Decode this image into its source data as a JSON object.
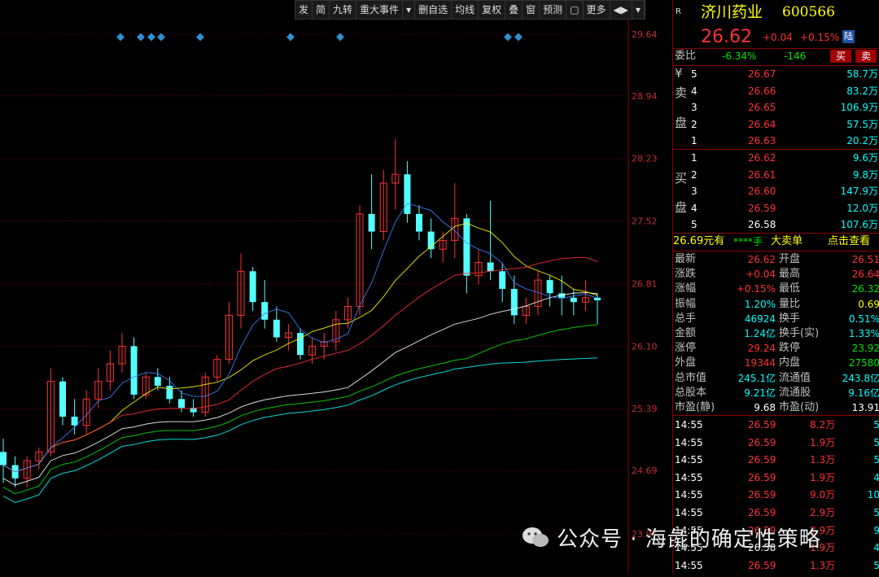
{
  "toolbar": {
    "items": [
      "发",
      "简",
      "九转",
      "重大事件",
      "▾",
      "删自选",
      "均线",
      "复权",
      "叠",
      "窗",
      "预测",
      "▢",
      "更多",
      "◀▶",
      "▾"
    ]
  },
  "chart": {
    "price_labels": [
      "29.64",
      "28.94",
      "28.23",
      "27.52",
      "26.81",
      "26.10",
      "25.39",
      "24.69",
      "23.97"
    ],
    "price_min": 23.97,
    "price_max": 29.64,
    "marker_x": [
      148,
      173,
      186,
      198,
      246,
      357,
      418,
      624,
      637
    ],
    "candles": [
      [
        24.9,
        25.05,
        24.55,
        24.75
      ],
      [
        24.75,
        24.85,
        24.5,
        24.6
      ],
      [
        24.6,
        24.85,
        24.5,
        24.8
      ],
      [
        24.8,
        24.95,
        24.7,
        24.9
      ],
      [
        24.9,
        25.85,
        24.85,
        25.7
      ],
      [
        25.7,
        25.75,
        25.2,
        25.3
      ],
      [
        25.3,
        25.5,
        25.1,
        25.2
      ],
      [
        25.2,
        25.6,
        25.1,
        25.5
      ],
      [
        25.5,
        25.85,
        25.4,
        25.7
      ],
      [
        25.7,
        26.05,
        25.6,
        25.9
      ],
      [
        25.9,
        26.25,
        25.8,
        26.1
      ],
      [
        26.1,
        26.2,
        25.5,
        25.55
      ],
      [
        25.55,
        25.8,
        25.5,
        25.75
      ],
      [
        25.75,
        25.85,
        25.6,
        25.65
      ],
      [
        25.65,
        25.75,
        25.45,
        25.5
      ],
      [
        25.5,
        25.6,
        25.35,
        25.4
      ],
      [
        25.4,
        25.5,
        25.3,
        25.35
      ],
      [
        25.35,
        25.8,
        25.3,
        25.75
      ],
      [
        25.75,
        26.0,
        25.7,
        25.95
      ],
      [
        25.95,
        26.6,
        25.9,
        26.45
      ],
      [
        26.45,
        27.15,
        26.3,
        26.95
      ],
      [
        26.95,
        27.0,
        26.5,
        26.6
      ],
      [
        26.6,
        26.85,
        26.3,
        26.4
      ],
      [
        26.4,
        26.55,
        26.15,
        26.2
      ],
      [
        26.2,
        26.35,
        26.05,
        26.25
      ],
      [
        26.25,
        26.3,
        25.95,
        26.0
      ],
      [
        26.0,
        26.2,
        25.9,
        26.1
      ],
      [
        26.1,
        26.25,
        25.95,
        26.15
      ],
      [
        26.15,
        26.5,
        26.05,
        26.4
      ],
      [
        26.4,
        26.65,
        26.3,
        26.55
      ],
      [
        26.55,
        27.7,
        26.45,
        27.6
      ],
      [
        27.6,
        28.05,
        27.2,
        27.4
      ],
      [
        27.4,
        28.1,
        27.3,
        27.95
      ],
      [
        27.95,
        28.45,
        27.65,
        28.05
      ],
      [
        28.05,
        28.2,
        27.5,
        27.6
      ],
      [
        27.6,
        27.7,
        27.3,
        27.4
      ],
      [
        27.4,
        27.55,
        27.1,
        27.2
      ],
      [
        27.2,
        27.4,
        27.05,
        27.3
      ],
      [
        27.3,
        27.95,
        27.1,
        27.55
      ],
      [
        27.55,
        27.6,
        26.7,
        26.9
      ],
      [
        26.9,
        27.2,
        26.8,
        27.05
      ],
      [
        27.05,
        27.75,
        26.85,
        26.95
      ],
      [
        26.95,
        27.05,
        26.6,
        26.75
      ],
      [
        26.75,
        26.9,
        26.35,
        26.45
      ],
      [
        26.45,
        26.65,
        26.35,
        26.55
      ],
      [
        26.55,
        26.95,
        26.45,
        26.85
      ],
      [
        26.85,
        26.9,
        26.55,
        26.7
      ],
      [
        26.7,
        26.9,
        26.45,
        26.65
      ],
      [
        26.65,
        26.75,
        26.45,
        26.6
      ],
      [
        26.6,
        26.85,
        26.5,
        26.65
      ],
      [
        26.65,
        26.7,
        26.35,
        26.62
      ]
    ],
    "ma_colors": [
      "#ffffff",
      "#ffff00",
      "#ff3232",
      "#00e600",
      "#00ffff",
      "#4080ff"
    ]
  },
  "stock": {
    "code_label": "R",
    "name": "济川药业",
    "code": "600566",
    "price": "26.62",
    "change": "+0.04",
    "change_pct": "+0.15%",
    "exchange_badge": "陆",
    "webi_label": "委比",
    "webi_pct": "-6.34%",
    "webi_diff": "-146",
    "buy_btn": "买",
    "sell_btn": "卖"
  },
  "sell_side": {
    "label_top": "¥",
    "label_chars": [
      "卖",
      "盘"
    ],
    "levels": [
      {
        "n": "5",
        "price": "26.67",
        "vol": "58.7万"
      },
      {
        "n": "4",
        "price": "26.66",
        "vol": "83.2万"
      },
      {
        "n": "3",
        "price": "26.65",
        "vol": "106.9万"
      },
      {
        "n": "2",
        "price": "26.64",
        "vol": "57.5万"
      },
      {
        "n": "1",
        "price": "26.63",
        "vol": "20.2万"
      }
    ]
  },
  "buy_side": {
    "label_chars": [
      "买",
      "盘"
    ],
    "levels": [
      {
        "n": "1",
        "price": "26.62",
        "vol": "9.6万"
      },
      {
        "n": "2",
        "price": "26.61",
        "vol": "9.8万"
      },
      {
        "n": "3",
        "price": "26.60",
        "vol": "147.9万"
      },
      {
        "n": "4",
        "price": "26.59",
        "vol": "12.0万"
      },
      {
        "n": "5",
        "price": "26.58",
        "vol": "107.6万"
      }
    ]
  },
  "bigorder": {
    "price_text": "26.69元有",
    "stars": "****手",
    "label": "大卖单",
    "link": "点击查看"
  },
  "stats": [
    {
      "l1": "最新",
      "v1": "26.62",
      "c1": "red",
      "l2": "开盘",
      "v2": "26.51",
      "c2": "red"
    },
    {
      "l1": "涨跌",
      "v1": "+0.04",
      "c1": "red",
      "l2": "最高",
      "v2": "26.64",
      "c2": "red"
    },
    {
      "l1": "涨幅",
      "v1": "+0.15%",
      "c1": "red",
      "l2": "最低",
      "v2": "26.32",
      "c2": "green"
    },
    {
      "l1": "振幅",
      "v1": "1.20%",
      "c1": "cyan",
      "l2": "量比",
      "v2": "0.69",
      "c2": "yellow"
    },
    {
      "l1": "总手",
      "v1": "46924",
      "c1": "cyan",
      "l2": "换手",
      "v2": "0.51%",
      "c2": "cyan"
    },
    {
      "l1": "金额",
      "v1": "1.24亿",
      "c1": "cyan",
      "l2": "换手(实)",
      "v2": "1.33%",
      "c2": "cyan"
    },
    {
      "l1": "涨停",
      "v1": "29.24",
      "c1": "red",
      "l2": "跌停",
      "v2": "23.92",
      "c2": "green"
    },
    {
      "l1": "外盘",
      "v1": "19344",
      "c1": "red",
      "l2": "内盘",
      "v2": "27580",
      "c2": "green"
    },
    {
      "l1": "总市值",
      "v1": "245.1亿",
      "c1": "cyan",
      "l2": "流通值",
      "v2": "243.8亿",
      "c2": "cyan"
    },
    {
      "l1": "总股本",
      "v1": "9.21亿",
      "c1": "cyan",
      "l2": "流通股",
      "v2": "9.16亿",
      "c2": "cyan"
    },
    {
      "l1": "市盈(静)",
      "v1": "9.68",
      "c1": "white",
      "l2": "市盈(动)",
      "v2": "13.91",
      "c2": "white"
    }
  ],
  "ticks": [
    {
      "t": "14:55",
      "p": "26.59",
      "v": "8.2万",
      "n": "5"
    },
    {
      "t": "14:55",
      "p": "26.59",
      "v": "1.9万",
      "n": "5"
    },
    {
      "t": "14:55",
      "p": "26.59",
      "v": "1.3万",
      "n": "5"
    },
    {
      "t": "14:55",
      "p": "26.59",
      "v": "1.9万",
      "n": "4"
    },
    {
      "t": "14:55",
      "p": "26.59",
      "v": "9.0万",
      "n": "10"
    },
    {
      "t": "14:55",
      "p": "26.59",
      "v": "2.9万",
      "n": "5"
    },
    {
      "t": "14:55",
      "p": "26.59",
      "v": "2.9万",
      "n": "9"
    },
    {
      "t": "14:55",
      "p": "26.58",
      "v": "1.9万",
      "n": "4"
    },
    {
      "t": "14:55",
      "p": "26.59",
      "v": "1.3万",
      "n": "5"
    }
  ],
  "watermark": {
    "text": "公众号 · 海彘的确定性策略"
  }
}
